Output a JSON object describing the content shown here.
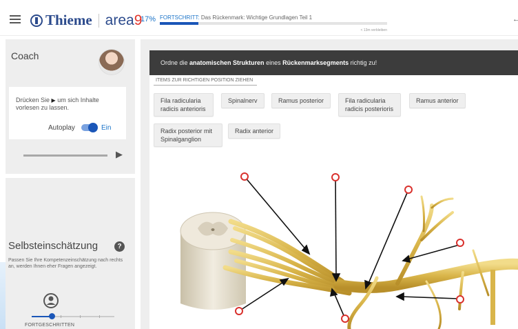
{
  "header": {
    "logo_brand": "Thieme",
    "logo_product": "area",
    "logo_product_digit": "9",
    "progress_percent": "17%",
    "progress_keyword": "FORTSCHRITT:",
    "progress_title": "Das Rückenmark: Wichtige Grundlagen Teil 1",
    "progress_value": 0.17,
    "time_remaining": "< 13m verbleiben"
  },
  "coach": {
    "title": "Coach",
    "read_aloud_before": "Drücken Sie",
    "read_aloud_after": "um sich Inhalte vorlesen zu lassen.",
    "autoplay_label": "Autoplay",
    "autoplay_state": "Ein"
  },
  "self_assessment": {
    "title": "Selbsteinschätzung",
    "help_symbol": "?",
    "description": "Passen Sie Ihre Kompetenzeinschätzung nach rechts an, werden Ihnen eher Fragen angezeigt.",
    "level_label": "FORTGESCHRITTEN",
    "level_value": 0.25
  },
  "task": {
    "instruction_1": "Ordne die ",
    "instruction_bold_1": "anatomischen Strukturen",
    "instruction_2": " eines ",
    "instruction_bold_2": "Rückenmarksegments",
    "instruction_3": " richtig zu!",
    "items_tab": "ITEMS ZUR RICHTIGEN POSITION ZIEHEN",
    "items": [
      "Fila radicularia radicis anterioris",
      "Spinalnerv",
      "Ramus posterior",
      "Fila radicularia radicis posterioris",
      "Ramus anterior",
      "Radix posterior mit Spinalganglion",
      "Radix anterior"
    ]
  },
  "colors": {
    "accent": "#1a56b8",
    "brand_blue": "#2b4a8c",
    "brand_red": "#e2342a",
    "drop_target": "#d9302c",
    "nerve": "#d9b54a"
  },
  "icons": [
    "menu-icon",
    "play-icon",
    "help-icon",
    "person-icon",
    "back-arrow-icon"
  ]
}
